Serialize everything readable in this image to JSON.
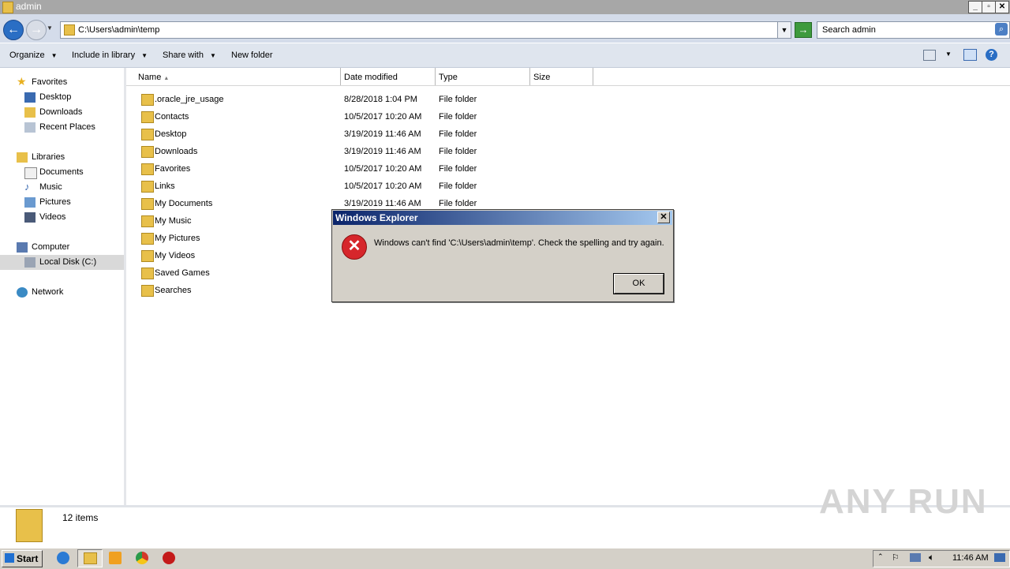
{
  "window": {
    "title": "admin"
  },
  "nav": {
    "address": "C:\\Users\\admin\\temp",
    "search_placeholder": "Search admin"
  },
  "toolbar": {
    "organize": "Organize",
    "include_in_library": "Include in library",
    "share_with": "Share with",
    "new_folder": "New folder"
  },
  "sidebar": {
    "favorites": "Favorites",
    "desktop": "Desktop",
    "downloads": "Downloads",
    "recent_places": "Recent Places",
    "libraries": "Libraries",
    "documents": "Documents",
    "music": "Music",
    "pictures": "Pictures",
    "videos": "Videos",
    "computer": "Computer",
    "local_disk": "Local Disk (C:)",
    "network": "Network"
  },
  "columns": {
    "name": "Name",
    "date_modified": "Date modified",
    "type": "Type",
    "size": "Size"
  },
  "files": [
    {
      "name": ".oracle_jre_usage",
      "date": "8/28/2018 1:04 PM",
      "type": "File folder"
    },
    {
      "name": "Contacts",
      "date": "10/5/2017 10:20 AM",
      "type": "File folder"
    },
    {
      "name": "Desktop",
      "date": "3/19/2019 11:46 AM",
      "type": "File folder"
    },
    {
      "name": "Downloads",
      "date": "3/19/2019 11:46 AM",
      "type": "File folder"
    },
    {
      "name": "Favorites",
      "date": "10/5/2017 10:20 AM",
      "type": "File folder"
    },
    {
      "name": "Links",
      "date": "10/5/2017 10:20 AM",
      "type": "File folder"
    },
    {
      "name": "My Documents",
      "date": "3/19/2019 11:46 AM",
      "type": "File folder"
    },
    {
      "name": "My Music",
      "date": "",
      "type": ""
    },
    {
      "name": "My Pictures",
      "date": "",
      "type": ""
    },
    {
      "name": "My Videos",
      "date": "",
      "type": ""
    },
    {
      "name": "Saved Games",
      "date": "",
      "type": ""
    },
    {
      "name": "Searches",
      "date": "",
      "type": ""
    }
  ],
  "status": {
    "item_count": "12 items"
  },
  "dialog": {
    "title": "Windows Explorer",
    "message": "Windows can't find 'C:\\Users\\admin\\temp'.  Check the spelling and try again.",
    "ok": "OK"
  },
  "taskbar": {
    "start": "Start",
    "clock": "11:46 AM"
  },
  "watermark": "ANY RUN"
}
